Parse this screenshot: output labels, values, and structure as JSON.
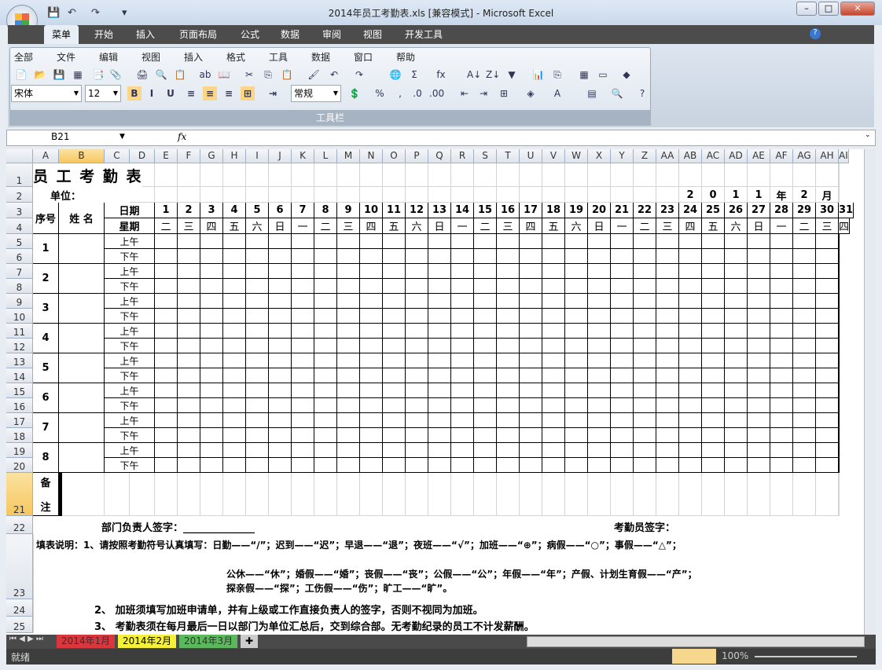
{
  "window": {
    "title": "2014年员工考勤表.xls  [兼容模式] - Microsoft Excel",
    "min": "–",
    "max": "□",
    "close": "✕"
  },
  "quick_access": {
    "save": "💾",
    "undo": "↶",
    "redo": "↷",
    "more": "▾"
  },
  "ribbon_tabs": [
    "菜单",
    "开始",
    "插入",
    "页面布局",
    "公式",
    "数据",
    "审阅",
    "视图",
    "开发工具"
  ],
  "classic_menu": [
    "全部",
    "文件",
    "编辑",
    "视图",
    "插入",
    "格式",
    "工具",
    "数据",
    "窗口",
    "帮助"
  ],
  "toolbar": {
    "font": "宋体",
    "size": "12",
    "number_format": "常规",
    "group_label": "工具栏",
    "bold": "B",
    "italic": "I",
    "underline": "U",
    "percent": "%",
    "comma": ",",
    "sum": "Σ",
    "fx": "fx"
  },
  "formula_bar": {
    "name_box": "B21",
    "fx": "fx",
    "value": ""
  },
  "columns": [
    "A",
    "B",
    "C",
    "D",
    "E",
    "F",
    "G",
    "H",
    "I",
    "J",
    "K",
    "L",
    "M",
    "N",
    "O",
    "P",
    "Q",
    "R",
    "S",
    "T",
    "U",
    "V",
    "W",
    "X",
    "Y",
    "Z",
    "AA",
    "AB",
    "AC",
    "AD",
    "AE",
    "AF",
    "AG",
    "AH",
    "AI"
  ],
  "selected_column": "B",
  "rows": [
    "1",
    "2",
    "3",
    "4",
    "5",
    "6",
    "7",
    "8",
    "9",
    "10",
    "11",
    "12",
    "13",
    "14",
    "15",
    "16",
    "17",
    "18",
    "19",
    "20",
    "21",
    "22",
    "23",
    "24",
    "25"
  ],
  "selected_row": "21",
  "sheet": {
    "title": "员 工 考 勤 表",
    "unit_label": "单位：",
    "date_parts": [
      "2",
      "0",
      "1",
      "1",
      "年",
      "2",
      "月"
    ],
    "seq_header": "序号",
    "name_header": "姓 名",
    "date_label": "日期",
    "weekday_label": "星期",
    "days": [
      "1",
      "2",
      "3",
      "4",
      "5",
      "6",
      "7",
      "8",
      "9",
      "10",
      "11",
      "12",
      "13",
      "14",
      "15",
      "16",
      "17",
      "18",
      "19",
      "20",
      "21",
      "22",
      "23",
      "24",
      "25",
      "26",
      "27",
      "28",
      "29",
      "30",
      "31"
    ],
    "weekdays": [
      "二",
      "三",
      "四",
      "五",
      "六",
      "日",
      "一",
      "二",
      "三",
      "四",
      "五",
      "六",
      "日",
      "一",
      "二",
      "三",
      "四",
      "五",
      "六",
      "日",
      "一",
      "二",
      "三",
      "四",
      "五",
      "六",
      "日",
      "一",
      "二",
      "三",
      "四"
    ],
    "employees": [
      "1",
      "2",
      "3",
      "4",
      "5",
      "6",
      "7",
      "8"
    ],
    "am": "上午",
    "pm": "下午",
    "remarks_top": "备",
    "remarks_bottom": "注",
    "dept_sign": "部门负责人签字：______________",
    "clerk_sign": "考勤员签字：",
    "note_line1": "填表说明：1、请按照考勤符号认真填写：日勤——“/”；迟到——“迟”；早退——“退”；夜班——“√”；加班——“⊕”；病假——“○”；事假——“△”；",
    "note_line2": "公休——“休”；婚假——“婚”；丧假——“丧”；公假——“公”；年假——“年”；产假、计划生育假——“产”；",
    "note_line3": "探亲假——“探”；工伤假——“伤”；旷工——“旷”。",
    "note_24": "2、 加班须填写加班申请单，并有上级或工作直接负责人的签字，否则不视同为加班。",
    "note_25": "3、 考勤表须在每月最后一日以部门为单位汇总后，交到综合部。无考勤纪录的员工不计发薪酬。"
  },
  "sheet_tabs": [
    {
      "label": "2014年1月",
      "color": "#d9363e"
    },
    {
      "label": "2014年2月",
      "color": "#f5f03a"
    },
    {
      "label": "2014年3月",
      "color": "#5cb85c"
    }
  ],
  "status": {
    "ready": "就绪",
    "zoom": "100%"
  }
}
